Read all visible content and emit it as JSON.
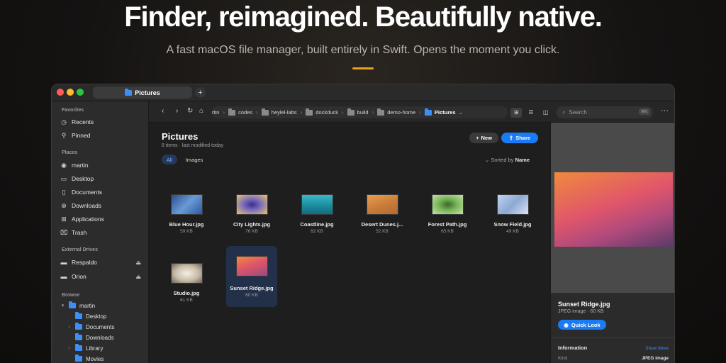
{
  "hero": {
    "title": "Finder, reimagined. Beautifully native.",
    "subtitle": "A fast macOS file manager, built entirely in Swift. Opens the moment you click.",
    "accent_color": "#e6a21c"
  },
  "window": {
    "tab_title": "Pictures",
    "tab_add": "+"
  },
  "sidebar": {
    "favorites_header": "Favorites",
    "favorites": [
      {
        "label": "Recents",
        "icon": "clock-icon"
      },
      {
        "label": "Pinned",
        "icon": "pin-icon"
      }
    ],
    "places_header": "Places",
    "places": [
      {
        "label": "martin",
        "icon": "user-icon"
      },
      {
        "label": "Desktop",
        "icon": "desktop-icon"
      },
      {
        "label": "Documents",
        "icon": "document-icon"
      },
      {
        "label": "Downloads",
        "icon": "download-icon"
      },
      {
        "label": "Applications",
        "icon": "apps-grid-icon"
      },
      {
        "label": "Trash",
        "icon": "trash-icon"
      }
    ],
    "drives_header": "External Drives",
    "drives": [
      {
        "label": "Respaldo",
        "icon": "drive-icon"
      },
      {
        "label": "Orion",
        "icon": "drive-icon"
      }
    ],
    "browse_header": "Browse",
    "tree": [
      {
        "label": "martin",
        "caret": "▾"
      },
      {
        "label": "Desktop",
        "caret": ""
      },
      {
        "label": "Documents",
        "caret": "›"
      },
      {
        "label": "Downloads",
        "caret": ""
      },
      {
        "label": "Library",
        "caret": "›"
      },
      {
        "label": "Movies",
        "caret": ""
      }
    ]
  },
  "toolbar": {
    "breadcrumbs": [
      "rtin",
      "codes",
      "heylel-labs",
      "dockduck",
      "build",
      "demo-home",
      "Pictures"
    ],
    "search_placeholder": "Search",
    "search_shortcut": "⌘K"
  },
  "main": {
    "title": "Pictures",
    "subtitle": "8 items · last modified today",
    "new_label": "New",
    "share_label": "Share",
    "filters": [
      "All",
      "Images"
    ],
    "sorted_prefix": "Sorted by",
    "sorted_value": "Name",
    "files": [
      {
        "name": "Blue Hour.jpg",
        "size": "59 KB"
      },
      {
        "name": "City Lights.jpg",
        "size": "76 KB"
      },
      {
        "name": "Coastline.jpg",
        "size": "62 KB"
      },
      {
        "name": "Desert Dunes.j...",
        "size": "52 KB"
      },
      {
        "name": "Forest Path.jpg",
        "size": "65 KB"
      },
      {
        "name": "Snow Field.jpg",
        "size": "49 KB"
      },
      {
        "name": "Studio.jpg",
        "size": "61 KB"
      },
      {
        "name": "Sunset Ridge.jpg",
        "size": "60 KB"
      }
    ]
  },
  "preview": {
    "name": "Sunset Ridge.jpg",
    "meta": "JPEG image · 60 KB",
    "quicklook_label": "Quick Look",
    "info_title": "Information",
    "show_more": "Show More",
    "kind_key": "Kind",
    "kind_value": "JPEG image"
  }
}
